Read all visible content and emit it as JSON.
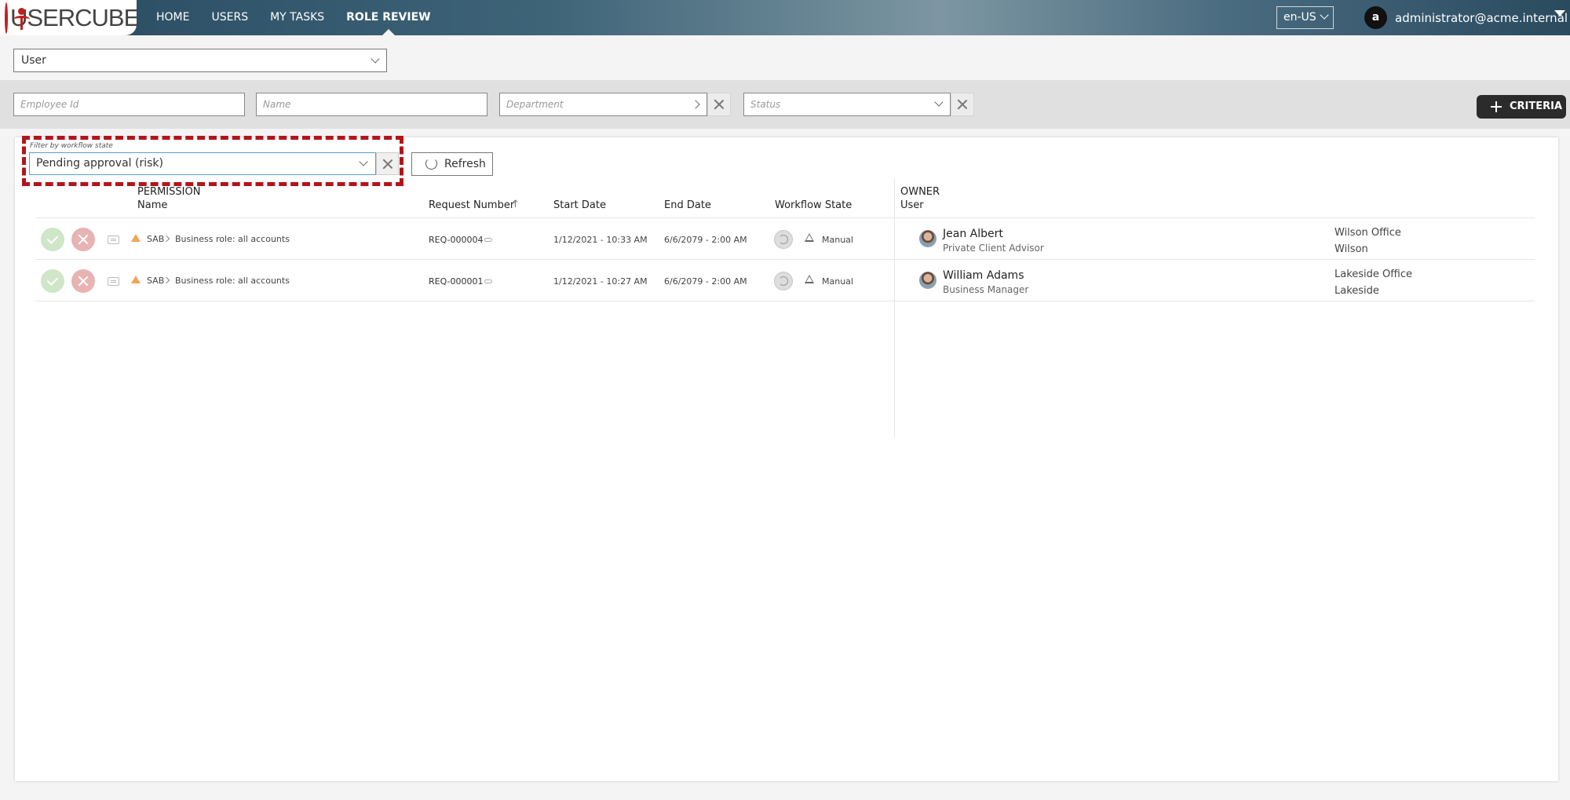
{
  "brand": {
    "name": "USERCUBE"
  },
  "nav": {
    "items": [
      "HOME",
      "USERS",
      "MY TASKS",
      "ROLE REVIEW"
    ],
    "active": "ROLE REVIEW"
  },
  "header": {
    "language": "en-US",
    "avatar_initial": "a",
    "user_email": "administrator@acme.internal"
  },
  "entity_select": {
    "value": "User"
  },
  "criteria": {
    "employee_id_placeholder": "Employee Id",
    "name_placeholder": "Name",
    "department_placeholder": "Department",
    "status_placeholder": "Status",
    "button_label": "CRITERIA"
  },
  "filter": {
    "label": "Filter by workflow state",
    "value": "Pending approval (risk)",
    "refresh_label": "Refresh"
  },
  "table": {
    "permission_group": "PERMISSION",
    "owner_group": "OWNER",
    "columns": {
      "name": "Name",
      "request_number": "Request Number",
      "sort_indicator": "↑",
      "start_date": "Start Date",
      "end_date": "End Date",
      "workflow_state": "Workflow State",
      "user": "User"
    },
    "rows": [
      {
        "resource": "SAB",
        "permission": "Business role: all accounts",
        "request_number": "REQ-000004",
        "start_date": "1/12/2021  - 10:33 AM",
        "end_date": "6/6/2079  - 2:00 AM",
        "workflow_state": "Manual",
        "owner_name": "Jean Albert",
        "owner_title": "Private Client Advisor",
        "site_office": "Wilson Office",
        "site": "Wilson"
      },
      {
        "resource": "SAB",
        "permission": "Business role: all accounts",
        "request_number": "REQ-000001",
        "start_date": "1/12/2021  - 10:27 AM",
        "end_date": "6/6/2079  - 2:00 AM",
        "workflow_state": "Manual",
        "owner_name": "William Adams",
        "owner_title": "Business Manager",
        "site_office": "Lakeside Office",
        "site": "Lakeside"
      }
    ]
  },
  "colors": {
    "highlight": "#b3141b",
    "approve": "#cfe6c9",
    "reject": "#e8b3b3",
    "warning": "#f0a45a"
  }
}
